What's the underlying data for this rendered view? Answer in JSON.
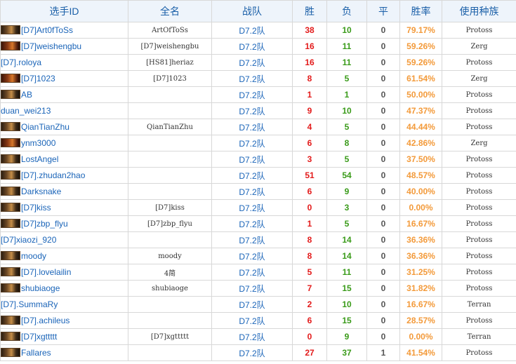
{
  "headers": [
    "选手ID",
    "全名",
    "战队",
    "胜",
    "负",
    "平",
    "胜率",
    "使用种族"
  ],
  "players": [
    {
      "id": "[D7]Art0fToSs",
      "avatar": true,
      "fullname": "ArtOfToSs",
      "team": "D7.2队",
      "wins": "38",
      "losses": "10",
      "draws": "0",
      "rate": "79.17%",
      "race": "Protoss"
    },
    {
      "id": "[D7]weishengbu",
      "avatar": true,
      "fullname": "[D7]weishengbu",
      "team": "D7.2队",
      "wins": "16",
      "losses": "11",
      "draws": "0",
      "rate": "59.26%",
      "race": "Zerg"
    },
    {
      "id": "[D7].roloya",
      "avatar": false,
      "fullname": "[HS81]heriaz",
      "team": "D7.2队",
      "wins": "16",
      "losses": "11",
      "draws": "0",
      "rate": "59.26%",
      "race": "Protoss"
    },
    {
      "id": "[D7]1023",
      "avatar": true,
      "fullname": "[D7]1023",
      "team": "D7.2队",
      "wins": "8",
      "losses": "5",
      "draws": "0",
      "rate": "61.54%",
      "race": "Zerg"
    },
    {
      "id": "AB",
      "avatar": true,
      "fullname": "",
      "team": "D7.2队",
      "wins": "1",
      "losses": "1",
      "draws": "0",
      "rate": "50.00%",
      "race": "Protoss"
    },
    {
      "id": "duan_wei213",
      "avatar": false,
      "fullname": "",
      "team": "D7.2队",
      "wins": "9",
      "losses": "10",
      "draws": "0",
      "rate": "47.37%",
      "race": "Protoss"
    },
    {
      "id": "QianTianZhu",
      "avatar": true,
      "fullname": "QianTianZhu",
      "team": "D7.2队",
      "wins": "4",
      "losses": "5",
      "draws": "0",
      "rate": "44.44%",
      "race": "Protoss"
    },
    {
      "id": "ynm3000",
      "avatar": true,
      "fullname": "",
      "team": "D7.2队",
      "wins": "6",
      "losses": "8",
      "draws": "0",
      "rate": "42.86%",
      "race": "Zerg"
    },
    {
      "id": "LostAngel",
      "avatar": true,
      "fullname": "",
      "team": "D7.2队",
      "wins": "3",
      "losses": "5",
      "draws": "0",
      "rate": "37.50%",
      "race": "Protoss"
    },
    {
      "id": "[D7].zhudan2hao",
      "avatar": true,
      "fullname": "",
      "team": "D7.2队",
      "wins": "51",
      "losses": "54",
      "draws": "0",
      "rate": "48.57%",
      "race": "Protoss"
    },
    {
      "id": "Darksnake",
      "avatar": true,
      "fullname": "",
      "team": "D7.2队",
      "wins": "6",
      "losses": "9",
      "draws": "0",
      "rate": "40.00%",
      "race": "Protoss"
    },
    {
      "id": "[D7]kiss",
      "avatar": true,
      "fullname": "[D7]kiss",
      "team": "D7.2队",
      "wins": "0",
      "losses": "3",
      "draws": "0",
      "rate": "0.00%",
      "race": "Protoss"
    },
    {
      "id": "[D7]zbp_flyu",
      "avatar": true,
      "fullname": "[D7]zbp_flyu",
      "team": "D7.2队",
      "wins": "1",
      "losses": "5",
      "draws": "0",
      "rate": "16.67%",
      "race": "Protoss"
    },
    {
      "id": "[D7]xiaozi_920",
      "avatar": false,
      "fullname": "",
      "team": "D7.2队",
      "wins": "8",
      "losses": "14",
      "draws": "0",
      "rate": "36.36%",
      "race": "Protoss"
    },
    {
      "id": "moody",
      "avatar": true,
      "fullname": "moody",
      "team": "D7.2队",
      "wins": "8",
      "losses": "14",
      "draws": "0",
      "rate": "36.36%",
      "race": "Protoss"
    },
    {
      "id": "[D7].lovelailin",
      "avatar": true,
      "fullname": "4简",
      "team": "D7.2队",
      "wins": "5",
      "losses": "11",
      "draws": "0",
      "rate": "31.25%",
      "race": "Protoss"
    },
    {
      "id": "shubiaoge",
      "avatar": true,
      "fullname": "shubiaoge",
      "team": "D7.2队",
      "wins": "7",
      "losses": "15",
      "draws": "0",
      "rate": "31.82%",
      "race": "Protoss"
    },
    {
      "id": "[D7].SummaRy",
      "avatar": false,
      "fullname": "",
      "team": "D7.2队",
      "wins": "2",
      "losses": "10",
      "draws": "0",
      "rate": "16.67%",
      "race": "Terran"
    },
    {
      "id": "[D7].achileus",
      "avatar": true,
      "fullname": "",
      "team": "D7.2队",
      "wins": "6",
      "losses": "15",
      "draws": "0",
      "rate": "28.57%",
      "race": "Protoss"
    },
    {
      "id": "[D7]xgttttt",
      "avatar": true,
      "fullname": "[D7]xgttttt",
      "team": "D7.2队",
      "wins": "0",
      "losses": "9",
      "draws": "0",
      "rate": "0.00%",
      "race": "Terran"
    },
    {
      "id": "Fallares",
      "avatar": true,
      "fullname": "",
      "team": "D7.2队",
      "wins": "27",
      "losses": "37",
      "draws": "1",
      "rate": "41.54%",
      "race": "Protoss"
    }
  ]
}
